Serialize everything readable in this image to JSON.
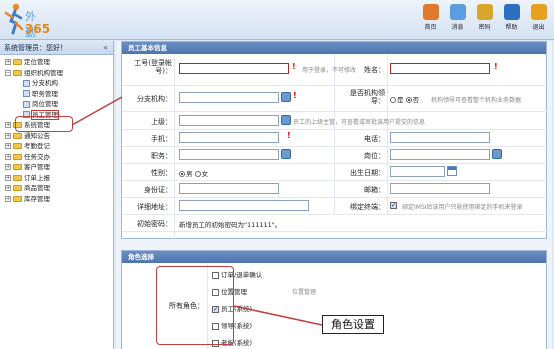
{
  "app": {
    "logo_line1": "外勤",
    "logo_line2": "365"
  },
  "topnav": [
    {
      "label": "首页",
      "icon": "home-icon",
      "color": "#e07a2a"
    },
    {
      "label": "消息",
      "icon": "message-icon",
      "color": "#5a9de0"
    },
    {
      "label": "密码",
      "icon": "lock-icon",
      "color": "#d9a52a"
    },
    {
      "label": "帮助",
      "icon": "help-icon",
      "color": "#2c6fbf"
    },
    {
      "label": "退出",
      "icon": "power-icon",
      "color": "#e8a11e"
    }
  ],
  "sidebar": {
    "title": "系统管理员：您好！",
    "collapse": "«",
    "items": [
      {
        "label": "定位管理",
        "level": 0,
        "toggle": "+"
      },
      {
        "label": "组织机构管理",
        "level": 0,
        "toggle": "−"
      },
      {
        "label": "分支机构",
        "level": 1
      },
      {
        "label": "职务管理",
        "level": 1
      },
      {
        "label": "岗位管理",
        "level": 1
      },
      {
        "label": "员工管理",
        "level": 1,
        "selected": true
      },
      {
        "label": "系统管理",
        "level": 0,
        "toggle": "+"
      },
      {
        "label": "通知公告",
        "level": 0,
        "toggle": "+"
      },
      {
        "label": "考勤登记",
        "level": 0,
        "toggle": "+"
      },
      {
        "label": "任务交办",
        "level": 0,
        "toggle": "+"
      },
      {
        "label": "客户管理",
        "level": 0,
        "toggle": "+"
      },
      {
        "label": "订单上报",
        "level": 0,
        "toggle": "+"
      },
      {
        "label": "商品管理",
        "level": 0,
        "toggle": "+"
      },
      {
        "label": "库存管理",
        "level": 0,
        "toggle": "+"
      }
    ]
  },
  "employee_panel": {
    "title": "员工基本信息",
    "account_label": "工号(登录帐号)：",
    "account_hint": "用于登录，不可修改",
    "name_label": "姓名：",
    "branch_label": "分支机构：",
    "is_leader_label": "是否机构领导：",
    "is_leader_options": [
      "是",
      "否"
    ],
    "is_leader_hint": "机构领导可查看整个机构业务数据",
    "superior_label": "上级：",
    "superior_hint": "员工的上级主管，可查看或审批该用户提交的信息",
    "mobile_label": "手机：",
    "phone_label": "电话：",
    "duty_label": "职务：",
    "post_label": "岗位：",
    "gender_label": "性别：",
    "gender_options": [
      "男",
      "女"
    ],
    "birthday_label": "出生日期：",
    "idcard_label": "身份证：",
    "email_label": "邮箱：",
    "address_label": "详细地址：",
    "bind_label": "绑定终端：",
    "bind_hint": "绑定IMSI后该用户只能使用绑定的手机来登录",
    "init_pwd_label": "初始密码：",
    "init_pwd_text": "新增员工的初始密码为\"111111\"。"
  },
  "role_panel": {
    "title": "角色选择",
    "all_roles_label": "所有角色：",
    "roles": [
      {
        "label": "订单/退单确认",
        "checked": false
      },
      {
        "label": "位置管理",
        "checked": false
      },
      {
        "label": "员工(系统)",
        "checked": true
      },
      {
        "label": "领导(系统)",
        "checked": false
      },
      {
        "label": "老板(系统)",
        "checked": false
      }
    ],
    "side_hint": "位置管理"
  },
  "callout": {
    "label": "角色设置"
  }
}
